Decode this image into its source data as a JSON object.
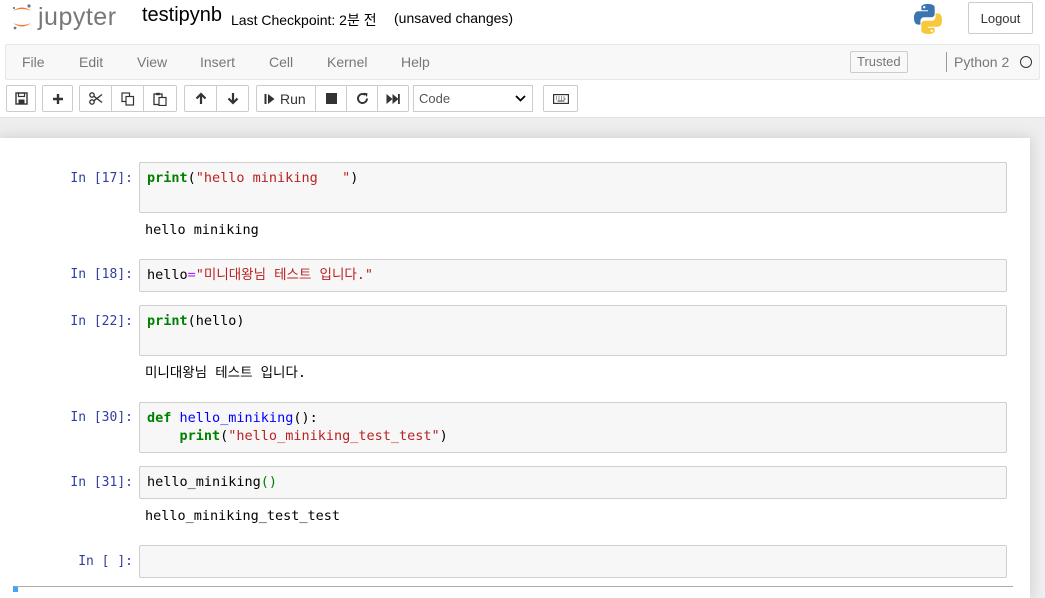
{
  "header": {
    "logo_text": "jupyter",
    "notebook_name": "testipynb",
    "checkpoint": "Last Checkpoint: 2분 전",
    "unsaved": "(unsaved changes)",
    "logout_label": "Logout"
  },
  "menubar": {
    "items": [
      "File",
      "Edit",
      "View",
      "Insert",
      "Cell",
      "Kernel",
      "Help"
    ],
    "trusted_label": "Trusted",
    "kernel_name": "Python 2"
  },
  "toolbar": {
    "run_label": "Run",
    "cell_type": "Code",
    "icons": [
      "save-icon",
      "plus-icon",
      "scissors-icon",
      "copy-icon",
      "paste-icon",
      "arrow-up-icon",
      "arrow-down-icon",
      "step-forward-icon",
      "stop-icon",
      "refresh-icon",
      "fast-forward-icon",
      "keyboard-icon"
    ]
  },
  "cells": [
    {
      "prompt": "In [17]:",
      "code_parts": [
        "print",
        "(",
        "\"hello miniking   \"",
        ")"
      ],
      "output": "hello miniking"
    },
    {
      "prompt": "In [18]:",
      "code_parts": [
        "hello",
        "=",
        "\"미니대왕님 테스트 입니다.\""
      ],
      "output": ""
    },
    {
      "prompt": "In [22]:",
      "code_parts": [
        "print",
        "(hello)"
      ],
      "output": "미니대왕님 테스트 입니다."
    },
    {
      "prompt": "In [30]:",
      "code_parts": [
        "def",
        " ",
        "hello_miniking",
        "():",
        "    ",
        "print",
        "(",
        "\"hello_miniking_test_test\"",
        ")"
      ],
      "output": ""
    },
    {
      "prompt": "In [31]:",
      "code_parts": [
        "hello_miniking",
        "()"
      ],
      "output": "hello_miniking_test_test"
    },
    {
      "prompt": "In [ ]:",
      "code_parts": [],
      "output": ""
    }
  ]
}
